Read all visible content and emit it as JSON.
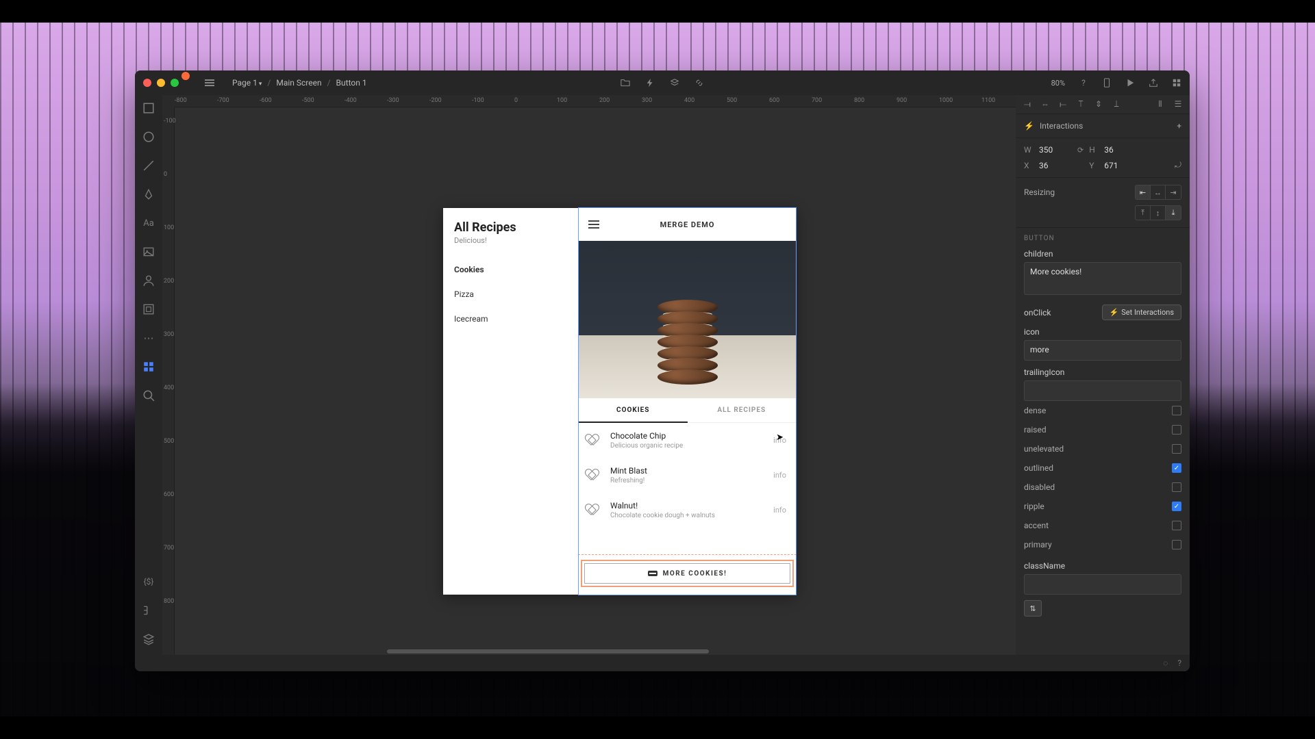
{
  "breadcrumb": {
    "page": "Page 1",
    "screen": "Main Screen",
    "element": "Button 1"
  },
  "zoom": "80%",
  "ruler_h": [
    "-800",
    "-700",
    "-600",
    "-500",
    "-400",
    "-300",
    "-200",
    "-100",
    "0",
    "100",
    "200",
    "300",
    "400",
    "500",
    "600",
    "700",
    "800",
    "900",
    "1000",
    "1100"
  ],
  "ruler_v": [
    "-100",
    "0",
    "100",
    "200",
    "300",
    "400",
    "500",
    "600",
    "700",
    "800"
  ],
  "sidebar": {
    "title": "All Recipes",
    "subtitle": "Delicious!",
    "items": [
      {
        "label": "Cookies",
        "active": true
      },
      {
        "label": "Pizza",
        "active": false
      },
      {
        "label": "Icecream",
        "active": false
      }
    ]
  },
  "screen": {
    "appbar_title": "MERGE DEMO",
    "tabs": [
      {
        "label": "COOKIES",
        "active": true
      },
      {
        "label": "ALL RECIPES",
        "active": false
      }
    ],
    "rows": [
      {
        "title": "Chocolate Chip",
        "sub": "Delicious organic recipe",
        "info": "info"
      },
      {
        "title": "Mint Blast",
        "sub": "Refreshing!",
        "info": "info"
      },
      {
        "title": "Walnut!",
        "sub": "Chocolate cookie dough + walnuts",
        "info": "info"
      }
    ],
    "more_button": "MORE COOKIES!"
  },
  "inspector": {
    "interactions_label": "Interactions",
    "dims": {
      "W": "350",
      "H": "36",
      "X": "36",
      "Y": "671"
    },
    "resizing_label": "Resizing",
    "section": "BUTTON",
    "children_label": "children",
    "children_value": "More cookies!",
    "onClick_label": "onClick",
    "set_interactions": "Set Interactions",
    "icon_label": "icon",
    "icon_value": "more",
    "trailingIcon_label": "trailingIcon",
    "trailingIcon_value": "",
    "checks": [
      {
        "label": "dense",
        "on": false
      },
      {
        "label": "raised",
        "on": false
      },
      {
        "label": "unelevated",
        "on": false
      },
      {
        "label": "outlined",
        "on": true
      },
      {
        "label": "disabled",
        "on": false
      },
      {
        "label": "ripple",
        "on": true
      },
      {
        "label": "accent",
        "on": false
      },
      {
        "label": "primary",
        "on": false
      }
    ],
    "className_label": "className",
    "className_value": ""
  }
}
